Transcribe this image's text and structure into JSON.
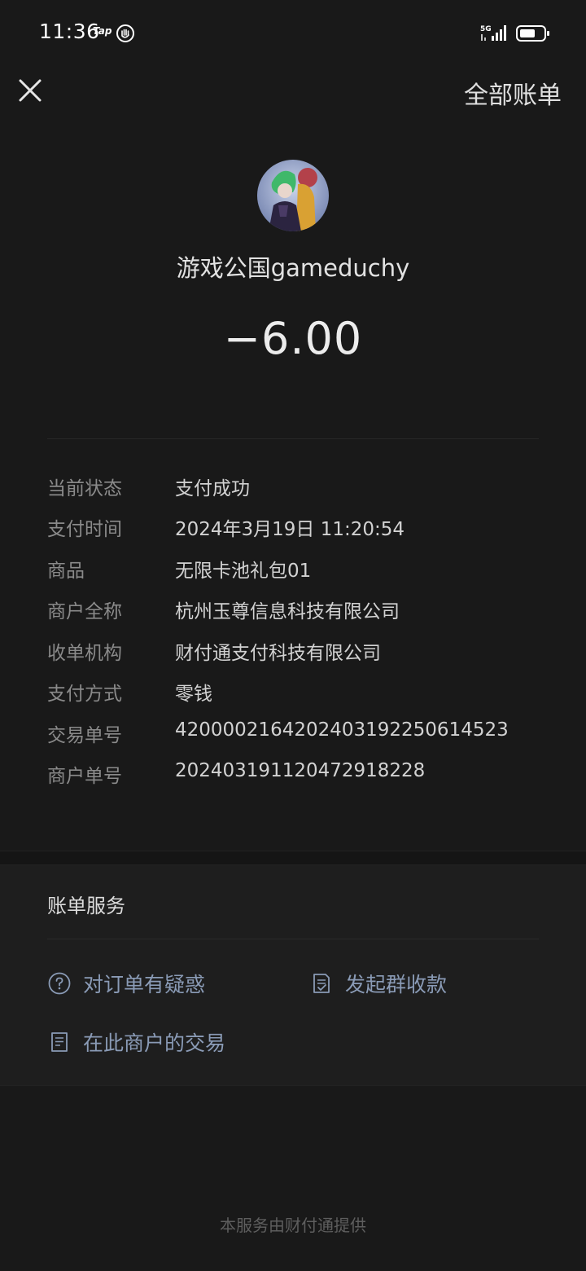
{
  "status_bar": {
    "time": "11:36",
    "tap_label": "Tap",
    "network": "5G"
  },
  "nav": {
    "close_icon": "close-icon",
    "all_bills_label": "全部账单"
  },
  "merchant": {
    "name": "游戏公国gameduchy",
    "amount": "−6.00"
  },
  "details": [
    {
      "label": "当前状态",
      "value": "支付成功"
    },
    {
      "label": "支付时间",
      "value": "2024年3月19日 11:20:54"
    },
    {
      "label": "商品",
      "value": "无限卡池礼包01"
    },
    {
      "label": "商户全称",
      "value": "杭州玉尊信息科技有限公司"
    },
    {
      "label": "收单机构",
      "value": "财付通支付科技有限公司"
    },
    {
      "label": "支付方式",
      "value": "零钱"
    },
    {
      "label": "交易单号",
      "value": "4200002164202403192250614523"
    },
    {
      "label": "商户单号",
      "value": "20240319112047291822​8"
    }
  ],
  "services": {
    "title": "账单服务",
    "items": [
      {
        "label": "对订单有疑惑",
        "icon": "question-circle-icon"
      },
      {
        "label": "发起群收款",
        "icon": "document-check-icon"
      },
      {
        "label": "在此商户的交易",
        "icon": "document-list-icon"
      }
    ]
  },
  "footer": "本服务由财付通提供",
  "colors": {
    "background": "#191919",
    "section_bg": "#1e1e1e",
    "link": "#8a9bb6",
    "label": "#8a8a8a"
  }
}
